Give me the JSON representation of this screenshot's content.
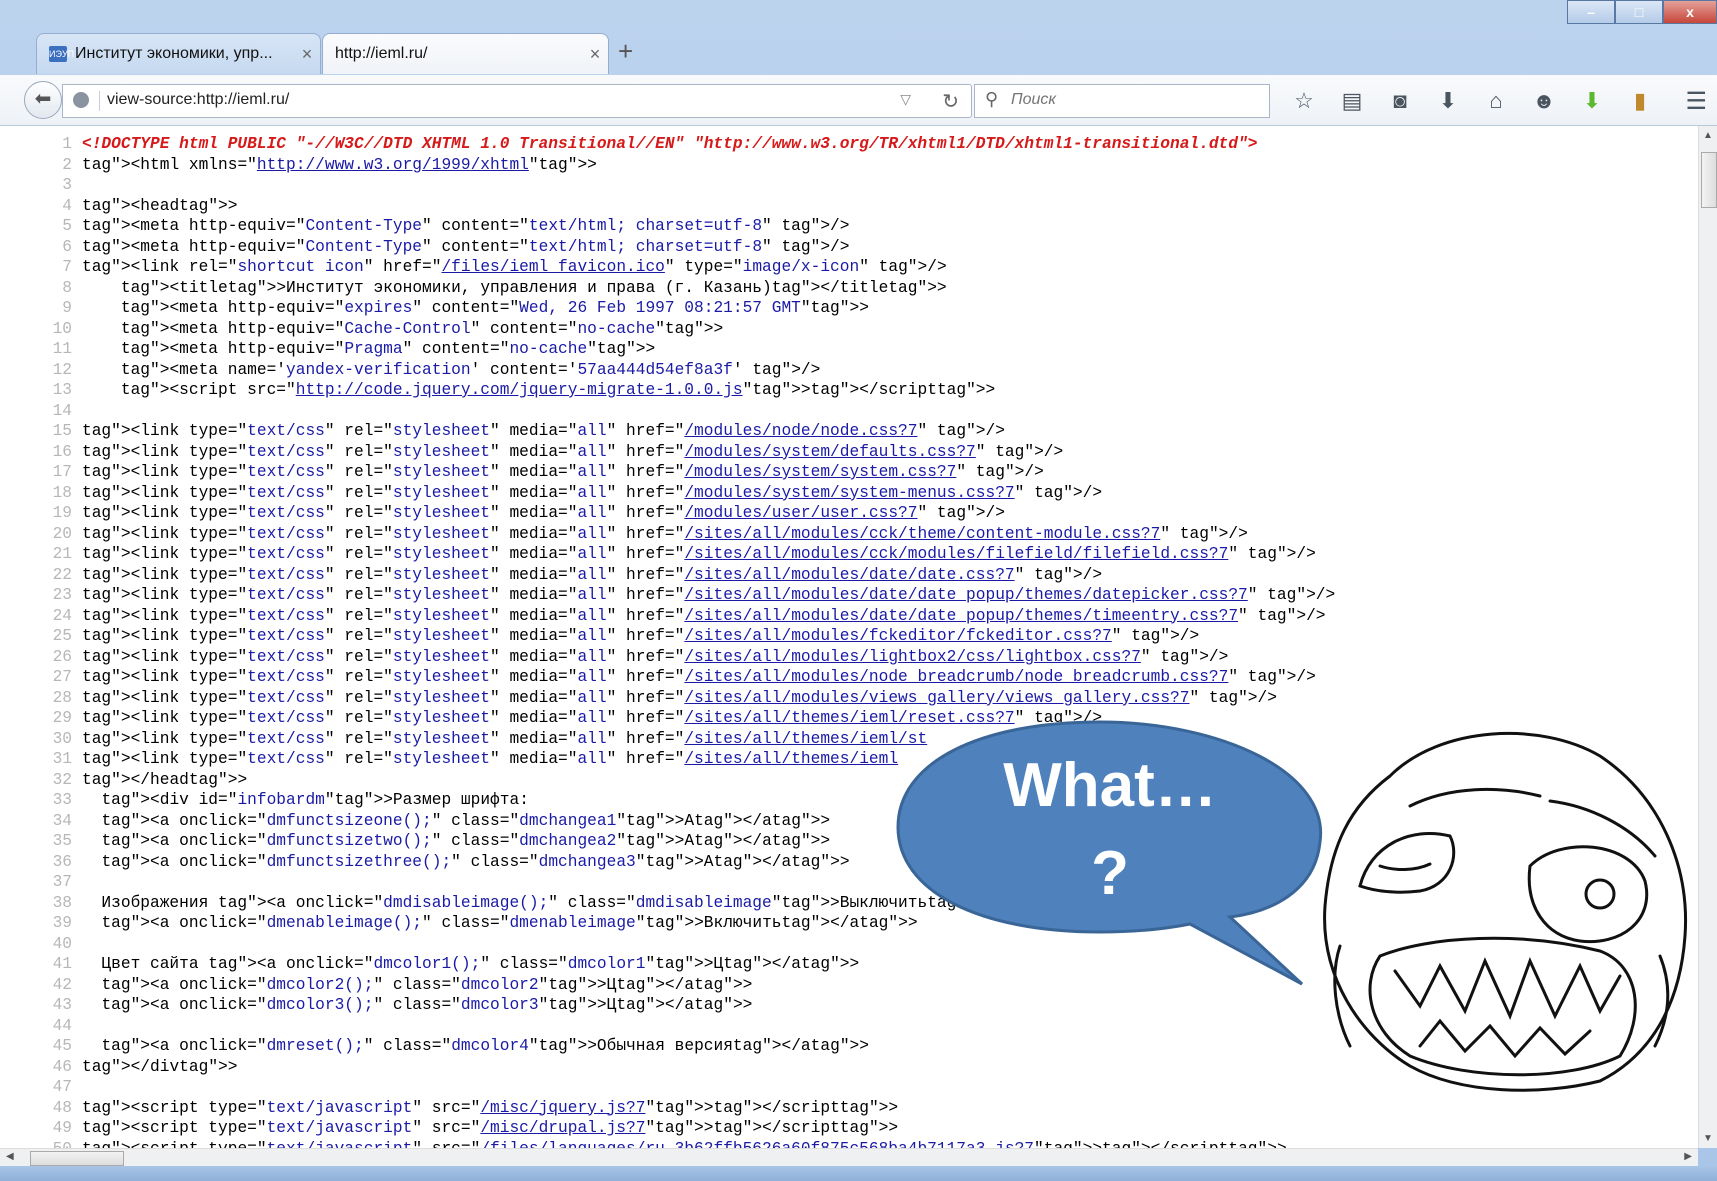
{
  "browser": {
    "tabs": [
      {
        "title": "Институт экономики, упр...",
        "close": "×"
      },
      {
        "title": "http://ieml.ru/",
        "close": "×"
      }
    ],
    "new_tab": "+",
    "window_controls": {
      "minimize": "–",
      "maximize": "□",
      "close": "x"
    },
    "url": "view-source:http://ieml.ru/",
    "search_placeholder": "Поиск"
  },
  "source_lines": [
    {
      "n": "1",
      "html": "<span class='dt'>&lt;!DOCTYPE html PUBLIC \"-//W3C//DTD XHTML 1.0 Transitional//EN\" \"http://www.w3.org/TR/xhtml1/DTD/xhtml1-transitional.dtd\"&gt;</span>"
    },
    {
      "n": "2",
      "html": "&lt;html xmlns=\"http://www.w3.org/1999/xhtml\"&gt;"
    },
    {
      "n": "3",
      "html": ""
    },
    {
      "n": "4",
      "html": "&lt;head&gt;"
    },
    {
      "n": "5",
      "html": "&lt;meta http-equiv=\"Content-Type\" content=\"text/html; charset=utf-8\" /&gt;"
    },
    {
      "n": "6",
      "html": "&lt;meta http-equiv=\"Content-Type\" content=\"text/html; charset=utf-8\" /&gt;"
    },
    {
      "n": "7",
      "html": "&lt;link rel=\"shortcut icon\" href=\"/files/ieml favicon.ico\" type=\"image/x-icon\" /&gt;"
    },
    {
      "n": "8",
      "html": "    &lt;title&gt;Институт экономики, управления и права (г. Казань)&lt;/title&gt;"
    },
    {
      "n": "9",
      "html": "    &lt;meta http-equiv=\"expires\" content=\"Wed, 26 Feb 1997 08:21:57 GMT\"&gt;"
    },
    {
      "n": "10",
      "html": "    &lt;meta http-equiv=\"Cache-Control\" content=\"no-cache\"&gt;"
    },
    {
      "n": "11",
      "html": "    &lt;meta http-equiv=\"Pragma\" content=\"no-cache\"&gt;"
    },
    {
      "n": "12",
      "html": "    &lt;meta name='yandex-verification' content='57aa444d54ef8a3f' /&gt;"
    },
    {
      "n": "13",
      "html": "    &lt;script src=\"http://code.jquery.com/jquery-migrate-1.0.0.js\"&gt;&lt;/script&gt;"
    },
    {
      "n": "14",
      "html": ""
    },
    {
      "n": "15",
      "html": "&lt;link type=\"text/css\" rel=\"stylesheet\" media=\"all\" href=\"/modules/node/node.css?7\" /&gt;"
    },
    {
      "n": "16",
      "html": "&lt;link type=\"text/css\" rel=\"stylesheet\" media=\"all\" href=\"/modules/system/defaults.css?7\" /&gt;"
    },
    {
      "n": "17",
      "html": "&lt;link type=\"text/css\" rel=\"stylesheet\" media=\"all\" href=\"/modules/system/system.css?7\" /&gt;"
    },
    {
      "n": "18",
      "html": "&lt;link type=\"text/css\" rel=\"stylesheet\" media=\"all\" href=\"/modules/system/system-menus.css?7\" /&gt;"
    },
    {
      "n": "19",
      "html": "&lt;link type=\"text/css\" rel=\"stylesheet\" media=\"all\" href=\"/modules/user/user.css?7\" /&gt;"
    },
    {
      "n": "20",
      "html": "&lt;link type=\"text/css\" rel=\"stylesheet\" media=\"all\" href=\"/sites/all/modules/cck/theme/content-module.css?7\" /&gt;"
    },
    {
      "n": "21",
      "html": "&lt;link type=\"text/css\" rel=\"stylesheet\" media=\"all\" href=\"/sites/all/modules/cck/modules/filefield/filefield.css?7\" /&gt;"
    },
    {
      "n": "22",
      "html": "&lt;link type=\"text/css\" rel=\"stylesheet\" media=\"all\" href=\"/sites/all/modules/date/date.css?7\" /&gt;"
    },
    {
      "n": "23",
      "html": "&lt;link type=\"text/css\" rel=\"stylesheet\" media=\"all\" href=\"/sites/all/modules/date/date popup/themes/datepicker.css?7\" /&gt;"
    },
    {
      "n": "24",
      "html": "&lt;link type=\"text/css\" rel=\"stylesheet\" media=\"all\" href=\"/sites/all/modules/date/date popup/themes/timeentry.css?7\" /&gt;"
    },
    {
      "n": "25",
      "html": "&lt;link type=\"text/css\" rel=\"stylesheet\" media=\"all\" href=\"/sites/all/modules/fckeditor/fckeditor.css?7\" /&gt;"
    },
    {
      "n": "26",
      "html": "&lt;link type=\"text/css\" rel=\"stylesheet\" media=\"all\" href=\"/sites/all/modules/lightbox2/css/lightbox.css?7\" /&gt;"
    },
    {
      "n": "27",
      "html": "&lt;link type=\"text/css\" rel=\"stylesheet\" media=\"all\" href=\"/sites/all/modules/node breadcrumb/node breadcrumb.css?7\" /&gt;"
    },
    {
      "n": "28",
      "html": "&lt;link type=\"text/css\" rel=\"stylesheet\" media=\"all\" href=\"/sites/all/modules/views gallery/views gallery.css?7\" /&gt;"
    },
    {
      "n": "29",
      "html": "&lt;link type=\"text/css\" rel=\"stylesheet\" media=\"all\" href=\"/sites/all/themes/ieml/reset.css?7\" /&gt;"
    },
    {
      "n": "30",
      "html": "&lt;link type=\"text/css\" rel=\"stylesheet\" media=\"all\" href=\"/sites/all/themes/ieml/st"
    },
    {
      "n": "31",
      "html": "&lt;link type=\"text/css\" rel=\"stylesheet\" media=\"all\" href=\"/sites/all/themes/ieml"
    },
    {
      "n": "32",
      "html": "&lt;/head&gt;"
    },
    {
      "n": "33",
      "html": "  &lt;div id=\"infobardm\"&gt;Размер шрифта:"
    },
    {
      "n": "34",
      "html": "  &lt;a onclick=\"dmfunctsizeone();\" class=\"dmchangea1\"&gt;A&lt;/a&gt;"
    },
    {
      "n": "35",
      "html": "  &lt;a onclick=\"dmfunctsizetwo();\" class=\"dmchangea2\"&gt;A&lt;/a&gt;"
    },
    {
      "n": "36",
      "html": "  &lt;a onclick=\"dmfunctsizethree();\" class=\"dmchangea3\"&gt;A&lt;/a&gt;"
    },
    {
      "n": "37",
      "html": ""
    },
    {
      "n": "38",
      "html": "  Изображения &lt;a onclick=\"dmdisableimage();\" class=\"dmdisableimage\"&gt;Выключить&lt;/a&gt;"
    },
    {
      "n": "39",
      "html": "  &lt;a onclick=\"dmenableimage();\" class=\"dmenableimage\"&gt;Включить&lt;/a&gt;"
    },
    {
      "n": "40",
      "html": ""
    },
    {
      "n": "41",
      "html": "  Цвет сайта &lt;a onclick=\"dmcolor1();\" class=\"dmcolor1\"&gt;Ц&lt;/a&gt;"
    },
    {
      "n": "42",
      "html": "  &lt;a onclick=\"dmcolor2();\" class=\"dmcolor2\"&gt;Ц&lt;/a&gt;"
    },
    {
      "n": "43",
      "html": "  &lt;a onclick=\"dmcolor3();\" class=\"dmcolor3\"&gt;Ц&lt;/a&gt;"
    },
    {
      "n": "44",
      "html": ""
    },
    {
      "n": "45",
      "html": "  &lt;a onclick=\"dmreset();\" class=\"dmcolor4\"&gt;Обычная версия&lt;/a&gt;"
    },
    {
      "n": "46",
      "html": "&lt;/div&gt;"
    },
    {
      "n": "47",
      "html": ""
    },
    {
      "n": "48",
      "html": "&lt;script type=\"text/javascript\" src=\"/misc/jquery.js?7\"&gt;&lt;/script&gt;"
    },
    {
      "n": "49",
      "html": "&lt;script type=\"text/javascript\" src=\"/misc/drupal.js?7\"&gt;&lt;/script&gt;"
    },
    {
      "n": "50",
      "html": "&lt;script type=\"text/javascript\" src=\"/files/languages/ru 3b62ffb5626a60f875c568ba4b7117a3.js?7\"&gt;&lt;/script&gt;"
    }
  ],
  "bubble": {
    "line1": "What…",
    "line2": "?"
  },
  "colors": {
    "bubble_fill": "#4f81bd",
    "bubble_stroke": "#3a6597",
    "tag": "#8b0e36",
    "attr_value": "#1a1aa6",
    "doctype": "#d61a1a"
  }
}
